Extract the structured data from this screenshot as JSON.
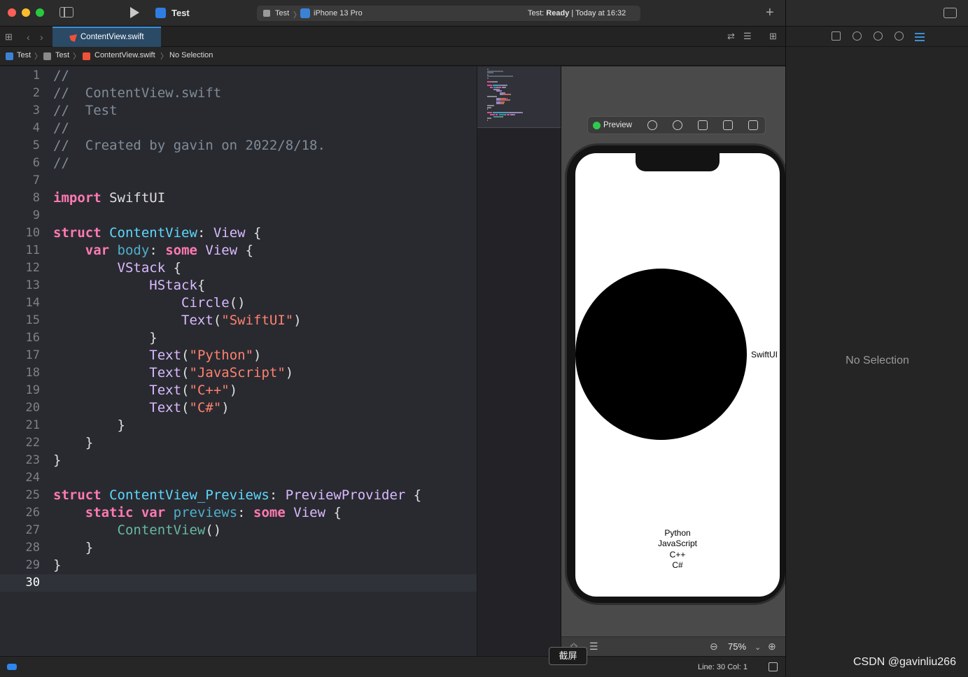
{
  "window": {
    "app_title": "Test",
    "scheme": "Test",
    "device": "iPhone 13 Pro",
    "status_prefix": "Test: ",
    "status_bold": "Ready",
    "status_suffix": " | Today at 16:32"
  },
  "tab": {
    "active_label": "ContentView.swift"
  },
  "jump_bar": {
    "project": "Test",
    "group": "Test",
    "file": "ContentView.swift",
    "selection": "No Selection"
  },
  "editor": {
    "lines": [
      [
        [
          "cm",
          "//"
        ]
      ],
      [
        [
          "cm",
          "//  ContentView.swift"
        ]
      ],
      [
        [
          "cm",
          "//  Test"
        ]
      ],
      [
        [
          "cm",
          "//"
        ]
      ],
      [
        [
          "cm",
          "//  Created by gavin on 2022/8/18."
        ]
      ],
      [
        [
          "cm",
          "//"
        ]
      ],
      [],
      [
        [
          "kw",
          "import"
        ],
        [
          "pl",
          " SwiftUI"
        ]
      ],
      [],
      [
        [
          "kw",
          "struct"
        ],
        [
          "pl",
          " "
        ],
        [
          "tyd",
          "ContentView"
        ],
        [
          "pl",
          ": "
        ],
        [
          "ty",
          "View"
        ],
        [
          "pl",
          " {"
        ]
      ],
      [
        [
          "pl",
          "    "
        ],
        [
          "kw",
          "var"
        ],
        [
          "pl",
          " "
        ],
        [
          "id",
          "body"
        ],
        [
          "pl",
          ": "
        ],
        [
          "kw",
          "some"
        ],
        [
          "pl",
          " "
        ],
        [
          "ty",
          "View"
        ],
        [
          "pl",
          " {"
        ]
      ],
      [
        [
          "pl",
          "        "
        ],
        [
          "ty",
          "VStack"
        ],
        [
          "pl",
          " {"
        ]
      ],
      [
        [
          "pl",
          "            "
        ],
        [
          "ty",
          "HStack"
        ],
        [
          "pl",
          "{"
        ]
      ],
      [
        [
          "pl",
          "                "
        ],
        [
          "ty",
          "Circle"
        ],
        [
          "pl",
          "()"
        ]
      ],
      [
        [
          "pl",
          "                "
        ],
        [
          "ty",
          "Text"
        ],
        [
          "pl",
          "("
        ],
        [
          "str",
          "\"SwiftUI\""
        ],
        [
          "pl",
          ")"
        ]
      ],
      [
        [
          "pl",
          "            }"
        ]
      ],
      [
        [
          "pl",
          "            "
        ],
        [
          "ty",
          "Text"
        ],
        [
          "pl",
          "("
        ],
        [
          "str",
          "\"Python\""
        ],
        [
          "pl",
          ")"
        ]
      ],
      [
        [
          "pl",
          "            "
        ],
        [
          "ty",
          "Text"
        ],
        [
          "pl",
          "("
        ],
        [
          "str",
          "\"JavaScript\""
        ],
        [
          "pl",
          ")"
        ]
      ],
      [
        [
          "pl",
          "            "
        ],
        [
          "ty",
          "Text"
        ],
        [
          "pl",
          "("
        ],
        [
          "str",
          "\"C++\""
        ],
        [
          "pl",
          ")"
        ]
      ],
      [
        [
          "pl",
          "            "
        ],
        [
          "ty",
          "Text"
        ],
        [
          "pl",
          "("
        ],
        [
          "str",
          "\"C#\""
        ],
        [
          "pl",
          ")"
        ]
      ],
      [
        [
          "pl",
          "        }"
        ]
      ],
      [
        [
          "pl",
          "    }"
        ]
      ],
      [
        [
          "pl",
          "}"
        ]
      ],
      [],
      [
        [
          "kw",
          "struct"
        ],
        [
          "pl",
          " "
        ],
        [
          "tyd",
          "ContentView_Previews"
        ],
        [
          "pl",
          ": "
        ],
        [
          "ty",
          "PreviewProvider"
        ],
        [
          "pl",
          " {"
        ]
      ],
      [
        [
          "pl",
          "    "
        ],
        [
          "kw",
          "static"
        ],
        [
          "pl",
          " "
        ],
        [
          "kw",
          "var"
        ],
        [
          "pl",
          " "
        ],
        [
          "id",
          "previews"
        ],
        [
          "pl",
          ": "
        ],
        [
          "kw",
          "some"
        ],
        [
          "pl",
          " "
        ],
        [
          "ty",
          "View"
        ],
        [
          "pl",
          " {"
        ]
      ],
      [
        [
          "pl",
          "        "
        ],
        [
          "fnd",
          "ContentView"
        ],
        [
          "pl",
          "()"
        ]
      ],
      [
        [
          "pl",
          "    }"
        ]
      ],
      [
        [
          "pl",
          "}"
        ]
      ],
      []
    ],
    "current_line": 30
  },
  "preview": {
    "label": "Preview",
    "hstack_text": "SwiftUI",
    "vstack_texts": [
      "Python",
      "JavaScript",
      "C++",
      "C#"
    ],
    "zoom": "75%"
  },
  "status_bar": {
    "line_col": "Line: 30  Col: 1"
  },
  "tooltip": "截屏",
  "inspector": {
    "empty_text": "No Selection"
  },
  "watermark": "CSDN @gavinliu266",
  "colors": {
    "keyword": "#ff7ab2",
    "type": "#dabaff",
    "declared_type": "#5dd8ff",
    "string": "#ff8170",
    "comment": "#7f8c98",
    "accent": "#3b8fd8"
  }
}
